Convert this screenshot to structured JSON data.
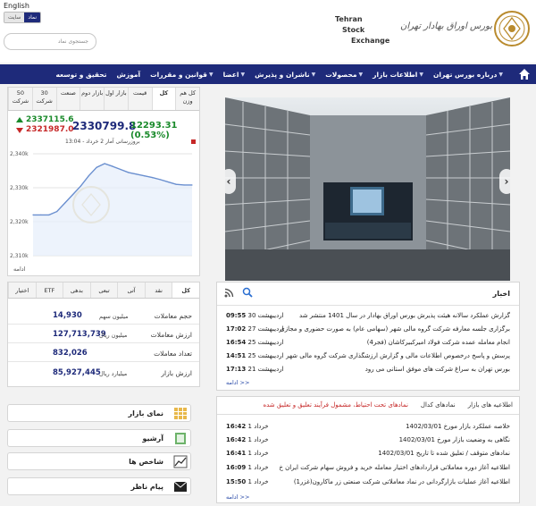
{
  "header": {
    "lang_link": "English",
    "mode_sign": "نماد",
    "mode_site": "سایت",
    "search_placeholder": "جستجوی نماد",
    "logo_en": [
      "Tehran",
      "Stock",
      "Exchange"
    ],
    "logo_fa": "بورس اوراق بهادار تهران"
  },
  "nav": {
    "items": [
      {
        "label": "درباره بورس تهران",
        "has_dropdown": true
      },
      {
        "label": "اطلاعات بازار",
        "has_dropdown": true
      },
      {
        "label": "محصولات",
        "has_dropdown": true
      },
      {
        "label": "ناشران و پذیرش",
        "has_dropdown": true
      },
      {
        "label": "اعضا",
        "has_dropdown": true
      },
      {
        "label": "قوانین و مقررات",
        "has_dropdown": true
      },
      {
        "label": "آموزش",
        "has_dropdown": false
      },
      {
        "label": "تحقیق و توسعه",
        "has_dropdown": false
      }
    ]
  },
  "market": {
    "tabs": [
      "کل هم وزن",
      "کل",
      "قیمت",
      "بازار اول",
      "بازار دوم",
      "صنعت",
      "30 شرکت",
      "50 شرکت"
    ],
    "active_tab": 1,
    "index_high": "2337115.6",
    "index_low": "2321987.0",
    "index_value": "2330799.8",
    "index_change": "12293.31 (0.53%)",
    "chart_caption": "بروزرسانی آمار 2 خرداد - 13:04",
    "more": "ادامه"
  },
  "chart_data": {
    "type": "area",
    "title": "",
    "xlabel": "",
    "ylabel": "",
    "ylim": [
      2310000,
      2340000
    ],
    "yticks": [
      "2,340k",
      "2,330k",
      "2,320k",
      "2,310k"
    ],
    "x": [
      0,
      1,
      2,
      3,
      4,
      5,
      6,
      7,
      8,
      9,
      10,
      11,
      12,
      13,
      14,
      15,
      16,
      17,
      18,
      19,
      20
    ],
    "values": [
      2322000,
      2322000,
      2322000,
      2323000,
      2325500,
      2328000,
      2330500,
      2333500,
      2336000,
      2337100,
      2336300,
      2335400,
      2334500,
      2334000,
      2333500,
      2333000,
      2332400,
      2331700,
      2331000,
      2330800,
      2330800
    ],
    "grid": true,
    "colors": {
      "line": "#6a8fcf",
      "fill": "#e6eefb"
    }
  },
  "stats": {
    "tabs": [
      "کل",
      "نقد",
      "آتی",
      "تبعی",
      "بدهی",
      "ETF",
      "اختیار"
    ],
    "active_tab": 0,
    "rows": [
      {
        "label": "حجم معاملات",
        "value": "14,930",
        "unit": "میلیون سهم"
      },
      {
        "label": "ارزش معاملات",
        "value": "127,713,739",
        "unit": "میلیون ریال"
      },
      {
        "label": "تعداد معاملات",
        "value": "832,026",
        "unit": ""
      },
      {
        "label": "ارزش بازار",
        "value": "85,927,445",
        "unit": "میلیارد ریال"
      }
    ]
  },
  "side_buttons": [
    {
      "label": "نمای بازار",
      "icon": "grid-icon"
    },
    {
      "label": "آرشیو",
      "icon": "archive-icon"
    },
    {
      "label": "شاخص ها",
      "icon": "chart-icon"
    },
    {
      "label": "پیام ناظر",
      "icon": "envelope-icon"
    }
  ],
  "news": {
    "title": "اخبار",
    "items": [
      {
        "text": "گزارش عملکرد سالانه هیئت پذیرش بورس اوراق بهادار در سال 1401 منتشر شد",
        "date": "30 اردیبهشت",
        "time": "09:55"
      },
      {
        "text": "برگزاری جلسه معارفه شرکت گروه مالی شهر (سهامی عام) به صورت حضوری و مجازی",
        "date": "27 اردیبهشت",
        "time": "17:02"
      },
      {
        "text": "انجام معامله عمده شرکت فولاد امیرکبیرکاشان (فجر4)",
        "date": "25 اردیبهشت",
        "time": "16:54"
      },
      {
        "text": "پرسش و پاسخ درخصوص اطلاعات مالی و گزارش ارزشگذاری شرکت گروه مالی شهر",
        "date": "25 اردیبهشت",
        "time": "14:51"
      },
      {
        "text": "بورس تهران به سراغ شرکت های موفق استانی می رود",
        "date": "21 اردیبهشت",
        "time": "17:13"
      }
    ],
    "more": "ادامه >>"
  },
  "notices": {
    "tabs": [
      "اطلاعیه های بازار",
      "نمادهای کدال",
      "نمادهای تحت احتیاط، مشمول فرآیند تعلیق و تعلیق شده"
    ],
    "items": [
      {
        "text": "خلاصه عملکرد بازار مورخ 1402/03/01",
        "date": "1 خرداد",
        "time": "16:42"
      },
      {
        "text": "نگاهی به وضعیت بازار مورخ 1402/03/01",
        "date": "1 خرداد",
        "time": "16:42"
      },
      {
        "text": "نمادهای متوقف / تعلیق شده تا تاریخ 1402/03/01",
        "date": "1 خرداد",
        "time": "16:41"
      },
      {
        "text": "اطلاعیه آغاز دوره معاملاتی قراردادهای اختیار معامله خرید و فروش سهام شرکت ایران خ",
        "date": "1 خرداد",
        "time": "16:09"
      },
      {
        "text": "اطلاعیه آغاز عملیات بازارگردانی در نماد معاملاتی شرکت صنعتی زر ماکارون(غزر1)",
        "date": "1 خرداد",
        "time": "15:50"
      }
    ],
    "more": "ادامه >>"
  }
}
